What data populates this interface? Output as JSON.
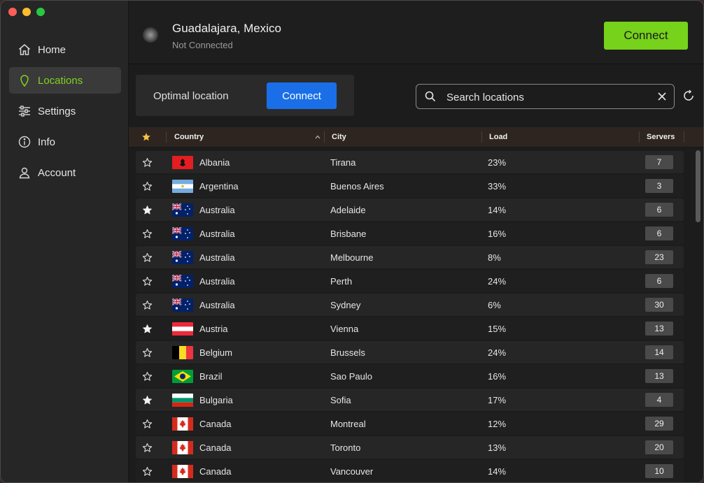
{
  "status": {
    "location": "Guadalajara, Mexico",
    "state": "Not Connected",
    "connect_label": "Connect"
  },
  "sidebar": {
    "items": [
      {
        "label": "Home",
        "icon": "home-icon"
      },
      {
        "label": "Locations",
        "icon": "pin-icon",
        "active": true
      },
      {
        "label": "Settings",
        "icon": "sliders-icon"
      },
      {
        "label": "Info",
        "icon": "info-icon"
      },
      {
        "label": "Account",
        "icon": "user-icon"
      }
    ]
  },
  "optimal": {
    "label": "Optimal location",
    "connect_label": "Connect"
  },
  "search": {
    "placeholder": "Search locations",
    "value": ""
  },
  "table": {
    "columns": [
      "Country",
      "City",
      "Load",
      "Servers"
    ],
    "rows": [
      {
        "fav": false,
        "flag": "AL",
        "country": "Albania",
        "city": "Tirana",
        "load": "23%",
        "servers": "7"
      },
      {
        "fav": false,
        "flag": "AR",
        "country": "Argentina",
        "city": "Buenos Aires",
        "load": "33%",
        "servers": "3"
      },
      {
        "fav": true,
        "flag": "AU",
        "country": "Australia",
        "city": "Adelaide",
        "load": "14%",
        "servers": "6"
      },
      {
        "fav": false,
        "flag": "AU",
        "country": "Australia",
        "city": "Brisbane",
        "load": "16%",
        "servers": "6"
      },
      {
        "fav": false,
        "flag": "AU",
        "country": "Australia",
        "city": "Melbourne",
        "load": "8%",
        "servers": "23"
      },
      {
        "fav": false,
        "flag": "AU",
        "country": "Australia",
        "city": "Perth",
        "load": "24%",
        "servers": "6"
      },
      {
        "fav": false,
        "flag": "AU",
        "country": "Australia",
        "city": "Sydney",
        "load": "6%",
        "servers": "30"
      },
      {
        "fav": true,
        "flag": "AT",
        "country": "Austria",
        "city": "Vienna",
        "load": "15%",
        "servers": "13"
      },
      {
        "fav": false,
        "flag": "BE",
        "country": "Belgium",
        "city": "Brussels",
        "load": "24%",
        "servers": "14"
      },
      {
        "fav": false,
        "flag": "BR",
        "country": "Brazil",
        "city": "Sao Paulo",
        "load": "16%",
        "servers": "13"
      },
      {
        "fav": true,
        "flag": "BG",
        "country": "Bulgaria",
        "city": "Sofia",
        "load": "17%",
        "servers": "4"
      },
      {
        "fav": false,
        "flag": "CA",
        "country": "Canada",
        "city": "Montreal",
        "load": "12%",
        "servers": "29"
      },
      {
        "fav": false,
        "flag": "CA",
        "country": "Canada",
        "city": "Toronto",
        "load": "13%",
        "servers": "20"
      },
      {
        "fav": false,
        "flag": "CA",
        "country": "Canada",
        "city": "Vancouver",
        "load": "14%",
        "servers": "10"
      }
    ]
  },
  "colors": {
    "accent_green": "#76d21a",
    "accent_blue": "#1a6fe8",
    "active_nav_text": "#7ed321"
  }
}
